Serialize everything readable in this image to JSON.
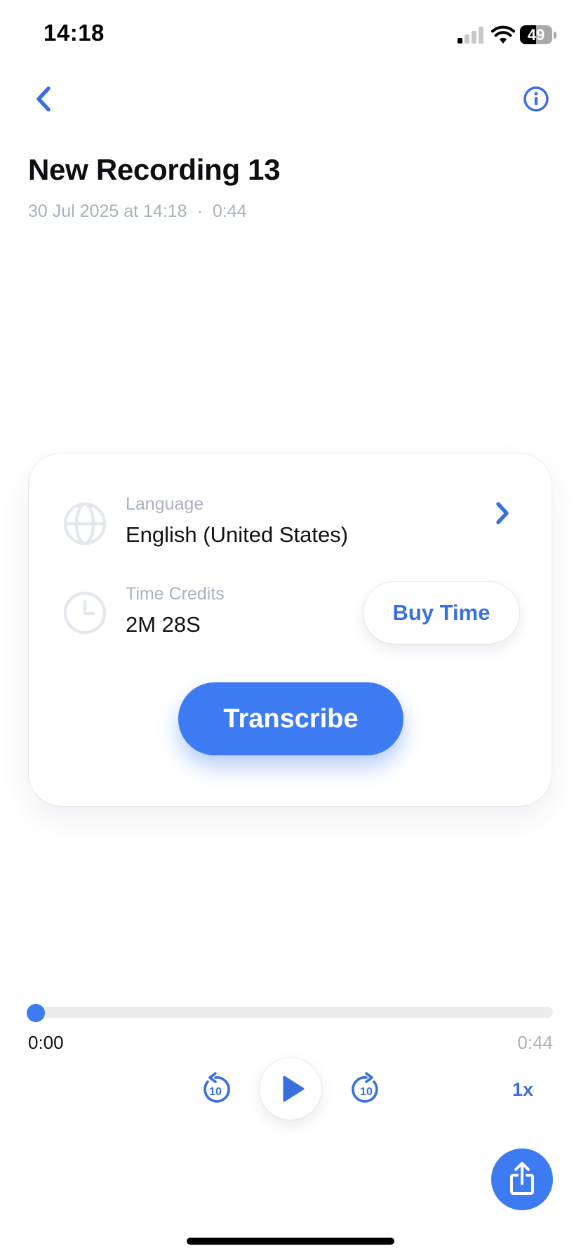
{
  "status_bar": {
    "time": "14:18",
    "battery": "49",
    "battery_level": 0.49
  },
  "header": {
    "title": "New Recording 13",
    "date": "30 Jul 2025 at 14:18",
    "separator": "·",
    "duration": "0:44"
  },
  "card": {
    "language_label": "Language",
    "language_value": "English (United States)",
    "credits_label": "Time Credits",
    "credits_value": "2M 28S",
    "buy_label": "Buy Time",
    "transcribe_label": "Transcribe"
  },
  "player": {
    "current_time": "0:00",
    "total_time": "0:44",
    "progress": 0.0,
    "skip_back_label": "10",
    "skip_forward_label": "10",
    "speed": "1x"
  },
  "colors": {
    "accent": "#3d7bf2",
    "text_muted": "#a9b1bd",
    "icon_gray": "#e4e8ee"
  },
  "icons": {
    "back": "chevron-left-icon",
    "info": "info-icon",
    "language": "globe-icon",
    "credits": "clock-icon",
    "language_chevron": "chevron-right-icon",
    "play": "play-icon",
    "share": "share-icon"
  }
}
